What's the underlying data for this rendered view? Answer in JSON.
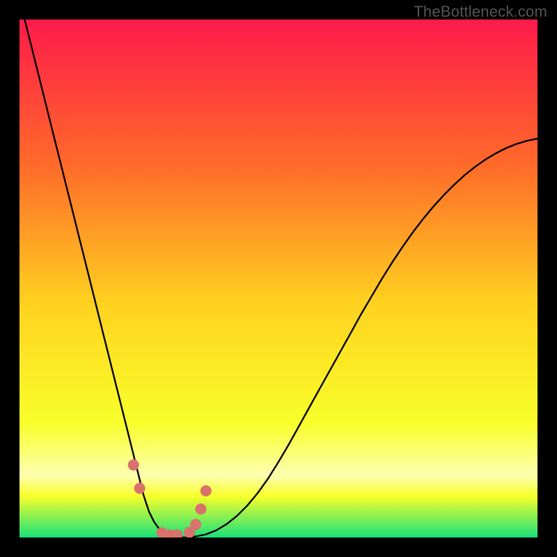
{
  "watermark": "TheBottleneck.com",
  "colors": {
    "bg_black": "#000000",
    "grad_top": "#ff1a4b",
    "grad_mid1": "#ff6a2a",
    "grad_mid2": "#ffd21f",
    "grad_mid3": "#f8ff2a",
    "grad_band_pale": "#fdffb0",
    "grad_bottom": "#18e07a",
    "curve": "#000000",
    "marker": "#d9716d"
  },
  "chart_data": {
    "type": "line",
    "title": "",
    "xlabel": "",
    "ylabel": "",
    "xlim": [
      0,
      100
    ],
    "ylim": [
      0,
      100
    ],
    "x": [
      0,
      2,
      4,
      6,
      8,
      10,
      12,
      14,
      16,
      18,
      20,
      22,
      23,
      24,
      25,
      26,
      27,
      28,
      29,
      30,
      32,
      34,
      36,
      38,
      40,
      42,
      44,
      46,
      48,
      50,
      52,
      54,
      56,
      58,
      60,
      62,
      64,
      66,
      68,
      70,
      72,
      74,
      76,
      78,
      80,
      82,
      84,
      86,
      88,
      90,
      92,
      94,
      96,
      98,
      100
    ],
    "values": [
      104,
      96,
      88,
      80,
      72,
      64,
      56,
      48,
      40,
      32,
      24,
      16,
      12,
      8,
      5,
      3,
      1.6,
      0.8,
      0.3,
      0,
      0,
      0.2,
      0.6,
      1.4,
      2.6,
      4.2,
      6.2,
      8.6,
      11.4,
      14.6,
      18.0,
      21.6,
      25.2,
      28.8,
      32.4,
      36.0,
      39.6,
      43.2,
      46.6,
      50.0,
      53.2,
      56.2,
      59.0,
      61.6,
      64.0,
      66.2,
      68.2,
      70.0,
      71.6,
      73.0,
      74.2,
      75.2,
      76.0,
      76.6,
      77.0
    ],
    "markers_x": [
      22,
      23.2,
      27.5,
      29.0,
      30.4,
      32.8,
      34.0,
      35.0,
      36.0
    ],
    "markers_y": [
      14,
      9.5,
      0.9,
      0.5,
      0.5,
      1.0,
      2.5,
      5.5,
      9.0
    ]
  }
}
